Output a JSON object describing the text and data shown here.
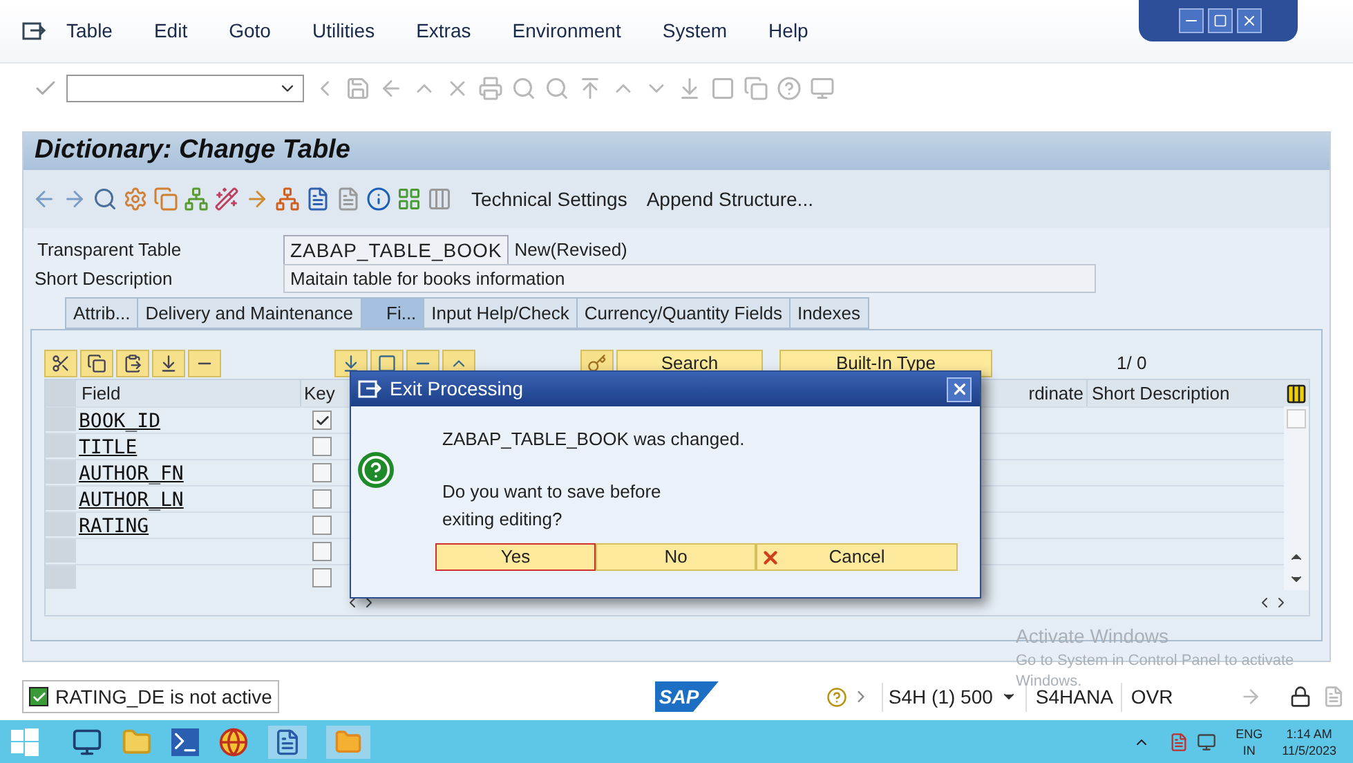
{
  "menu": [
    "Table",
    "Edit",
    "Goto",
    "Utilities",
    "Extras",
    "Environment",
    "System",
    "Help"
  ],
  "title": "Dictionary: Change Table",
  "app_toolbar": [
    "Technical Settings",
    "Append Structure..."
  ],
  "header": {
    "table_label": "Transparent Table",
    "table_name": "ZABAP_TABLE_BOOK",
    "table_status": "New(Revised)",
    "desc_label": "Short Description",
    "desc_value": "Maitain table for books information"
  },
  "tabs": [
    {
      "label": "Attrib...",
      "selected": false
    },
    {
      "label": "Delivery and Maintenance",
      "selected": false
    },
    {
      "label": "Fi...",
      "selected": true
    },
    {
      "label": "Input Help/Check",
      "selected": false
    },
    {
      "label": "Currency/Quantity Fields",
      "selected": false
    },
    {
      "label": "Indexes",
      "selected": false
    }
  ],
  "table_toolbar": {
    "buttons": [
      "Search",
      "Built-In Type"
    ],
    "counter": "1/ 0"
  },
  "table": {
    "columns": [
      "Field",
      "Key",
      "rdinate",
      "Short Description"
    ],
    "rows": [
      {
        "field": "BOOK_ID",
        "key": true
      },
      {
        "field": "TITLE",
        "key": false
      },
      {
        "field": "AUTHOR_FN",
        "key": false
      },
      {
        "field": "AUTHOR_LN",
        "key": false
      },
      {
        "field": "RATING",
        "key": false
      },
      {
        "key": false
      },
      {
        "key": false
      }
    ]
  },
  "dialog": {
    "title": "Exit Processing",
    "message": "ZABAP_TABLE_BOOK was changed.",
    "question_lines": [
      "Do you want to save before",
      "exiting editing?"
    ],
    "buttons": [
      {
        "label": "Yes",
        "kind": "plain",
        "selected": true
      },
      {
        "label": "No",
        "kind": "plain",
        "selected": false
      },
      {
        "label": "Cancel",
        "kind": "cancel",
        "selected": false
      }
    ]
  },
  "status_bar": {
    "message": "RATING_DE is not active",
    "logo": "SAP",
    "system": "S4H (1) 500",
    "server": "S4HANA",
    "mode": "OVR"
  },
  "watermark": {
    "title": "Activate Windows",
    "lines": [
      "Go to System in Control Panel to activate",
      "Windows."
    ]
  },
  "taskbar": {
    "language": "ENG",
    "region": "IN",
    "time": "1:14 AM",
    "date": "11/5/2023"
  }
}
